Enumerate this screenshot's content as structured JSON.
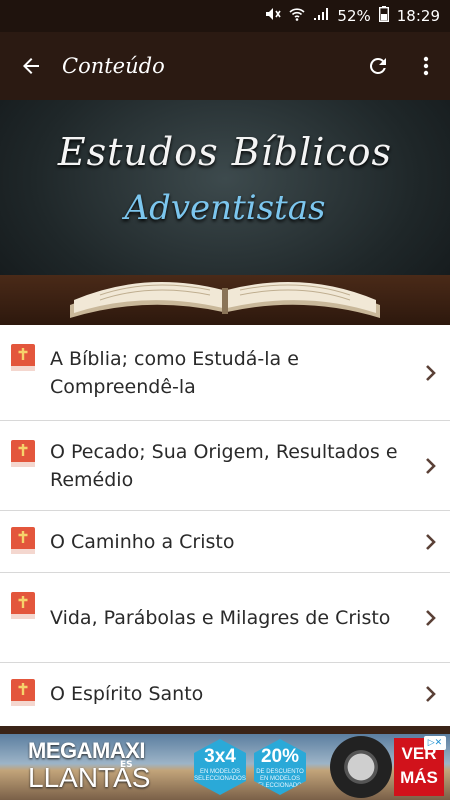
{
  "status_bar": {
    "battery": "52%",
    "time": "18:29"
  },
  "app_bar": {
    "title": "Conteúdo",
    "back_icon": "arrow-left-icon",
    "refresh_icon": "refresh-icon",
    "menu_icon": "more-vert-icon"
  },
  "banner": {
    "line1": "Estudos Bíblicos",
    "line2": "Adventistas"
  },
  "list": {
    "items": [
      {
        "label": "A Bíblia; como Estudá-la e Compreendê-la"
      },
      {
        "label": "O Pecado; Sua Origem, Resultados e Remédio"
      },
      {
        "label": "O Caminho a Cristo"
      },
      {
        "label": "Vida, Parábolas e Milagres de Cristo"
      },
      {
        "label": "O Espírito Santo"
      }
    ]
  },
  "ad": {
    "brand_line1": "MEGAMAXI",
    "brand_es": "ES",
    "brand_line2": "LLANTAS",
    "offer1_big": "3x4",
    "offer1_small": "EN MODELOS SELECCIONADOS",
    "offer2_big": "20%",
    "offer2_small": "DE DESCUENTO EN MODELOS SELECCIONADOS",
    "cta": "VER MÁS"
  },
  "colors": {
    "app_bar": "#2b1a12",
    "status_bar": "#1f130d",
    "bible_icon_red": "#e3563c",
    "chevron": "#5a4036"
  }
}
